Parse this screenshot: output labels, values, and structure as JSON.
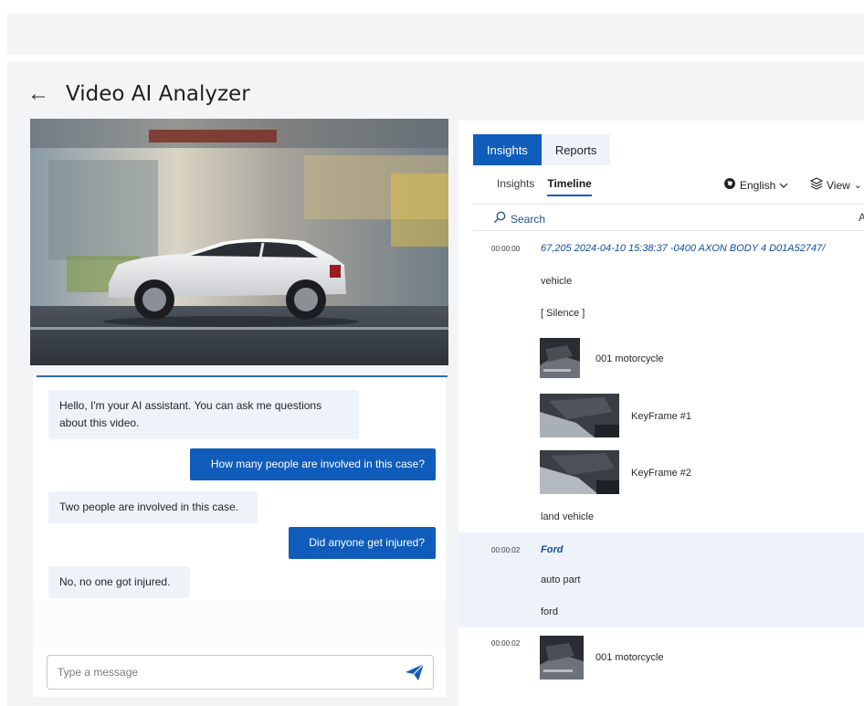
{
  "page": {
    "title": "Video AI Analyzer",
    "back_icon": "arrow-left-icon"
  },
  "chat": {
    "messages": [
      {
        "role": "assistant",
        "text": "Hello, I'm your AI assistant. You can ask me questions about this video."
      },
      {
        "role": "user",
        "text": "How many people are involved in this case?"
      },
      {
        "role": "assistant",
        "text": "Two people are involved in this case."
      },
      {
        "role": "user",
        "text": "Did anyone get injured?"
      },
      {
        "role": "assistant",
        "text": "No, no one got injured."
      }
    ],
    "input_placeholder": "Type a message",
    "send_icon": "send-icon"
  },
  "panel": {
    "tabs": [
      {
        "label": "Insights",
        "active": true
      },
      {
        "label": "Reports",
        "active": false
      }
    ],
    "subtabs": [
      {
        "label": "Insights",
        "active": false
      },
      {
        "label": "Timeline",
        "active": true
      }
    ],
    "language": "English",
    "view_label": "View",
    "search_label": "Search",
    "search_right_letter": "A"
  },
  "timeline": [
    {
      "time": "00:00:00",
      "meta": "67,205  2024-04-10 15:38:37 -0400  AXON BODY 4 D01A52747/",
      "labels": [
        "vehicle",
        "[ Silence ]"
      ],
      "items": [
        {
          "type": "thumb",
          "label": "001 motorcycle"
        },
        {
          "type": "keyframe",
          "label": "KeyFrame #1"
        },
        {
          "type": "keyframe",
          "label": "KeyFrame #2"
        }
      ],
      "trailing_label": "land vehicle"
    },
    {
      "time": "00:00:02",
      "meta": "Ford",
      "labels": [
        "auto part",
        "ford"
      ],
      "highlighted": true
    },
    {
      "time": "00:00:02",
      "items": [
        {
          "type": "thumb",
          "label": "001 motorcycle"
        }
      ]
    }
  ],
  "colors": {
    "accent": "#0f5cba",
    "ai_bubble": "#eef3fa",
    "highlight_row": "#eef3fa"
  }
}
